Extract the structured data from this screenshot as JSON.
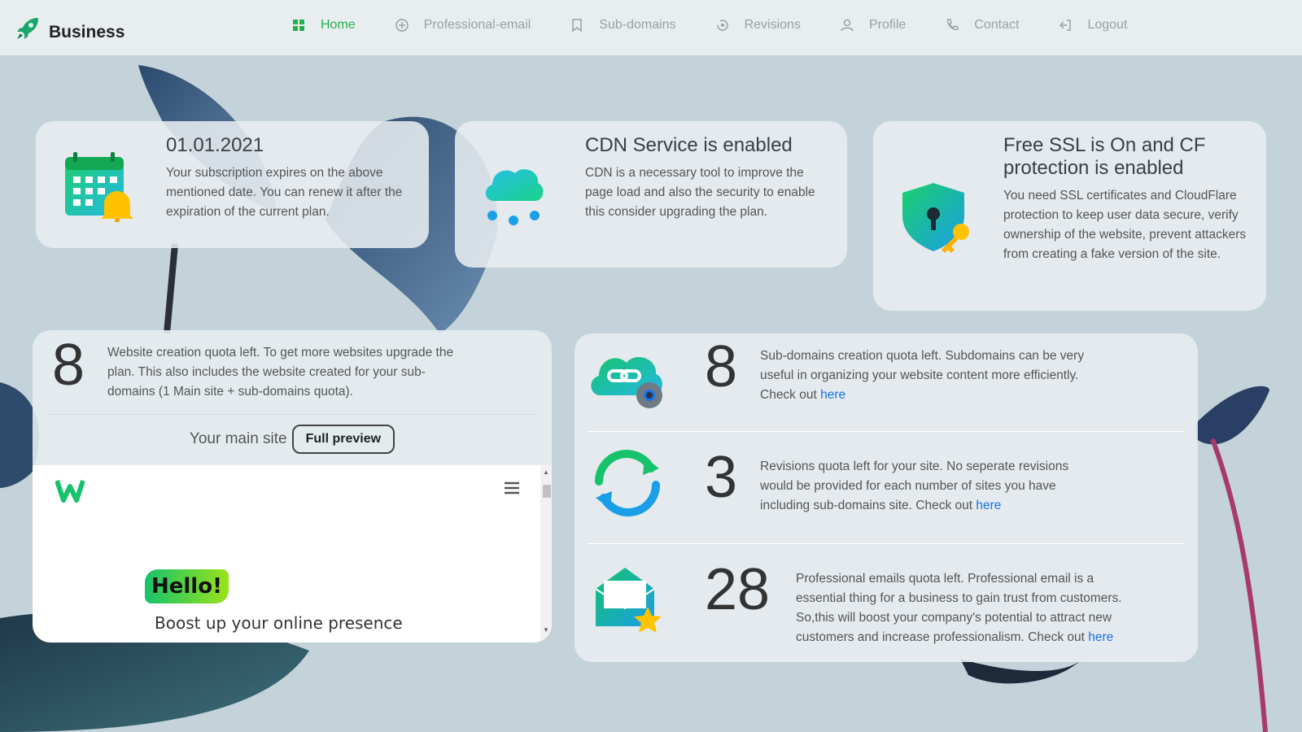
{
  "brand": {
    "name": "Business"
  },
  "nav": {
    "items": [
      {
        "label": "Home",
        "icon": "grid-icon",
        "active": true
      },
      {
        "label": "Professional-email",
        "icon": "plus-circle-icon"
      },
      {
        "label": "Sub-domains",
        "icon": "bookmark-icon"
      },
      {
        "label": "Revisions",
        "icon": "history-icon"
      },
      {
        "label": "Profile",
        "icon": "user-icon"
      },
      {
        "label": "Contact",
        "icon": "phone-icon"
      },
      {
        "label": "Logout",
        "icon": "logout-icon"
      }
    ]
  },
  "cards": {
    "subscription": {
      "title": "01.01.2021",
      "text": "Your subscription expires on the above mentioned date. You can renew it after the expiration of the current plan.",
      "icon": "calendar-bell-icon"
    },
    "cdn": {
      "title": "CDN Service is enabled",
      "text": "CDN is a necessary tool to improve the page load and also the security to enable this consider upgrading the plan.",
      "icon": "cloud-icon"
    },
    "ssl": {
      "title": "Free SSL is On and CF protection is enabled",
      "text": "You need SSL certificates and CloudFlare protection to keep user data secure, verify ownership of the website, prevent attackers from creating a fake version of the site.",
      "icon": "shield-key-icon"
    }
  },
  "websites": {
    "count": "8",
    "text": "Website creation quota left. To get more websites upgrade the plan. This also includes the website created for your sub-domains (1 Main site + sub-domains quota).",
    "main_site_label": "Your main site",
    "preview_button": "Full preview",
    "preview": {
      "logo": "W",
      "hello": "Hello!",
      "tagline": "Boost up your online presence"
    }
  },
  "quotas": {
    "subdomains": {
      "count": "8",
      "text": "Sub-domains creation quota left. Subdomains can be very useful in organizing your website content more efficiently. Check out",
      "link": "here",
      "icon": "cloud-link-gear-icon"
    },
    "revisions": {
      "count": "3",
      "text": "Revisions quota left for your site. No seperate revisions would be provided for each number of sites you have including sub-domains site. Check out",
      "link": "here",
      "icon": "refresh-icon"
    },
    "emails": {
      "count": "28",
      "text": "Professional emails quota left. Professional email is a essential thing for a business to gain trust from customers. So,this will boost your company's potential to attract new customers and increase professionalism. Check out",
      "link": "here",
      "icon": "mail-star-icon"
    }
  },
  "colors": {
    "accent": "#22b24c",
    "link": "#1a73e8",
    "background": "#c3d3d9"
  }
}
